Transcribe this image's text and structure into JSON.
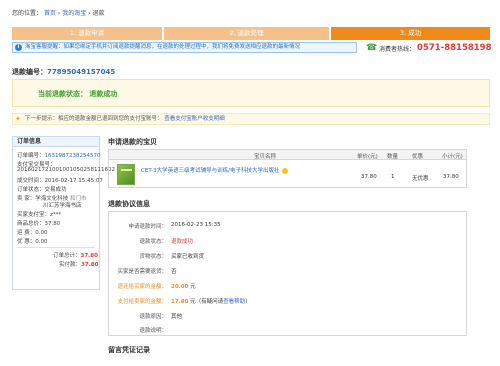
{
  "breadcrumb": {
    "prefix": "您的位置：",
    "home": "首页",
    "sep1": "›",
    "my_taobao": "我的淘宝",
    "sep2": "›",
    "current": "退款"
  },
  "steps": [
    "1. 退款申请",
    "2. 退款处理",
    "3. 成功"
  ],
  "notice": {
    "icon": "i",
    "text": "淘宝客服提醒：如果您绑定手机并订阅退款提醒消息，在退款的处理过程中，我们将免费发送相应退款的最新情况"
  },
  "hotline": {
    "label": "消费者热线：",
    "number": "0571-88158198"
  },
  "refund_no": {
    "label": "退款编号：",
    "value": "77895049157045"
  },
  "status": {
    "text": "当前退款状态：  退款成功"
  },
  "hint": {
    "text": "下一步提示：相应的退款金额已退回到您的支付宝账号：",
    "link": "查看支付宝账户收支明细"
  },
  "order": {
    "title": "订单信息",
    "order_no_label": "订单编号：",
    "order_no": "1631987238254570",
    "alipay_no_label": "支付宝交易号：",
    "alipay_no": "2016021721001001050258111602",
    "deal_time_label": "成交时间：",
    "deal_time": "2016-02-17 15:45:07",
    "status_label": "订单状态：",
    "status": "交易成功",
    "seller_label": "卖    家：",
    "seller": "学海文化科技",
    "seller_extra": "和门市",
    "seller_extra2": "川汇苏学海书店",
    "buyer_label": "买家支付宝：",
    "buyer": "z***",
    "price_label": "商品总价：",
    "price": "37.80",
    "shipping_label": "运    费：",
    "shipping": "0.00",
    "discount_label": "优    惠：",
    "discount": "0.00",
    "total_label": "订单总计：",
    "total": "37.80",
    "paid_label": "实付款：",
    "paid": "37.80"
  },
  "goods": {
    "title": "申请退款的宝贝",
    "headers": [
      "宝贝名称",
      "单价(元)",
      "数量",
      "优惠",
      "小计(元)"
    ],
    "rows": [
      {
        "name": "CET-3大学英语三级考试辅导与训练/电子科技大学出版社",
        "price": "37.80",
        "qty": "1",
        "discount": "无优惠",
        "subtotal": "37.80"
      }
    ]
  },
  "agreement": {
    "title": "退款协议信息",
    "apply_time_label": "申请退款时间：",
    "apply_time": "2016-02-23  15:35",
    "status_label": "退款状态：",
    "status": "退款成功",
    "goods_status_label": "货物状态：",
    "goods_status": "买家已收到货",
    "need_return_label": "买家是否需要退货：",
    "need_return": "否",
    "amount_label": "退还给买家的金额：",
    "amount": "20.00",
    "amount_unit": "元",
    "alipay_label": "支付给卖家的金额：",
    "alipay_amount": "17.80",
    "alipay_unit": "元（有疑问请",
    "alipay_link": "查看帮助",
    "alipay_end": "）",
    "reason_label": "退款原因：",
    "reason": "其他",
    "desc_label": "退款说明：",
    "desc": ""
  },
  "records": {
    "title": "留言凭证记录"
  }
}
